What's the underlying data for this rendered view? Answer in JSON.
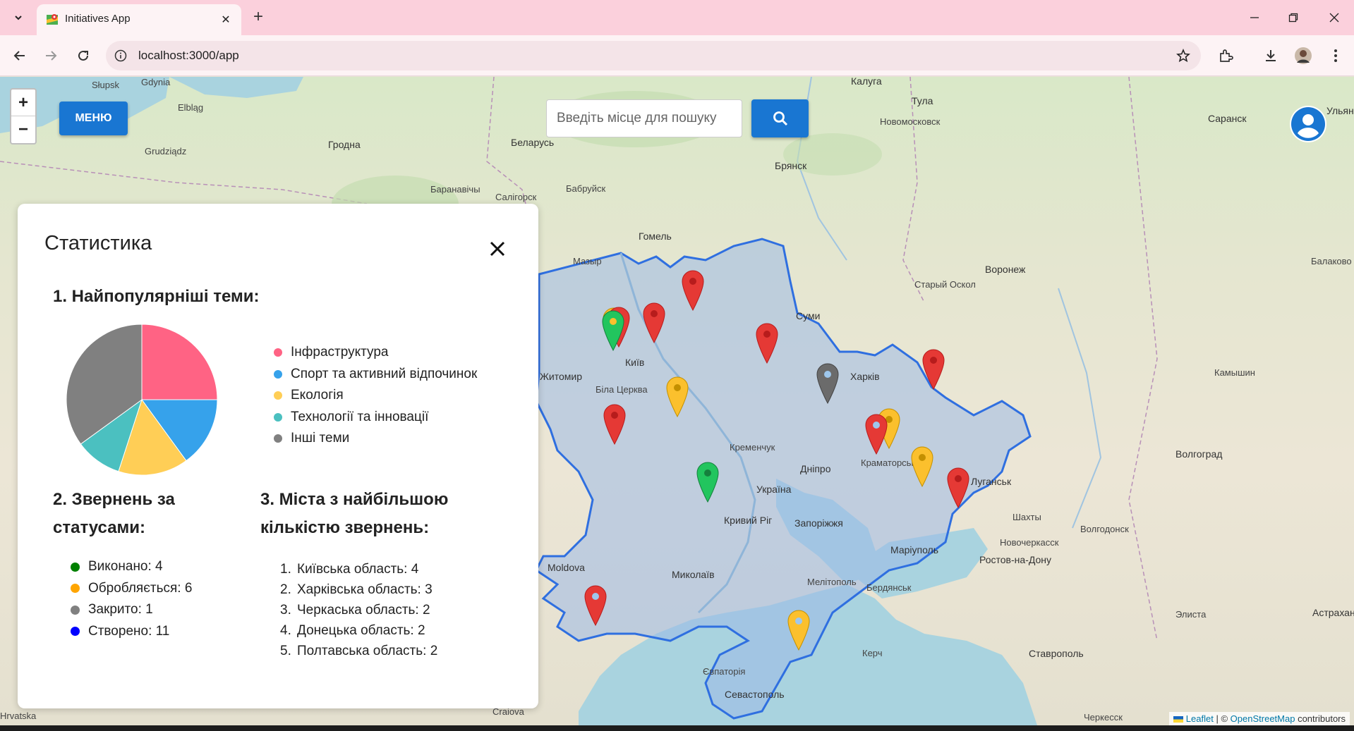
{
  "browser": {
    "tab_title": "Initiatives App",
    "url": "localhost:3000/app"
  },
  "map": {
    "menu_label": "МЕНЮ",
    "search_placeholder": "Введіть місце для пошуку",
    "zoom_in": "+",
    "zoom_out": "−",
    "attribution": {
      "leaflet": "Leaflet",
      "separator": "| ©",
      "osm": "OpenStreetMap",
      "contributors": "contributors"
    },
    "labels": [
      {
        "name": "Słupsk"
      },
      {
        "name": "Gdynia"
      },
      {
        "name": "Elbląg"
      },
      {
        "name": "Grudziądz"
      },
      {
        "name": "Калуга"
      },
      {
        "name": "Тула"
      },
      {
        "name": "Новомосковск"
      },
      {
        "name": "Саранск"
      },
      {
        "name": "Ульяновск"
      },
      {
        "name": "Гродна"
      },
      {
        "name": "Беларусь"
      },
      {
        "name": "Брянск"
      },
      {
        "name": "Баранавічы"
      },
      {
        "name": "Бабруйск"
      },
      {
        "name": "Салігорск"
      },
      {
        "name": "Гомель"
      },
      {
        "name": "Мазыр"
      },
      {
        "name": "Старый Оскол"
      },
      {
        "name": "Воронеж"
      },
      {
        "name": "Балаково"
      },
      {
        "name": "Суми"
      },
      {
        "name": "Житомир"
      },
      {
        "name": "Київ"
      },
      {
        "name": "Біла Церква"
      },
      {
        "name": "Харків"
      },
      {
        "name": "Камышин"
      },
      {
        "name": "Кременчук"
      },
      {
        "name": "Дніпро"
      },
      {
        "name": "Україна"
      },
      {
        "name": "Краматорськ"
      },
      {
        "name": "Луганськ"
      },
      {
        "name": "Волгоград"
      },
      {
        "name": "Кривий Ріг"
      },
      {
        "name": "Запоріжжя"
      },
      {
        "name": "Маріуполь"
      },
      {
        "name": "Шахты"
      },
      {
        "name": "Волгодонск"
      },
      {
        "name": "Новочеркасск"
      },
      {
        "name": "Ростов-на-Дону"
      },
      {
        "name": "Moldova"
      },
      {
        "name": "Миколаїв"
      },
      {
        "name": "Мелітополь"
      },
      {
        "name": "Бердянськ"
      },
      {
        "name": "Элиста"
      },
      {
        "name": "Астрахань"
      },
      {
        "name": "Керч"
      },
      {
        "name": "Ставрополь"
      },
      {
        "name": "Євпаторія"
      },
      {
        "name": "Севастополь"
      },
      {
        "name": "Craiova"
      },
      {
        "name": "Hrvatska"
      },
      {
        "name": "Черкесск"
      }
    ]
  },
  "stats": {
    "title": "Статистика",
    "section1_title": "1. Найпопулярніші теми:",
    "section2_title_line1": "2. Звернень за",
    "section2_title_line2": "статусами:",
    "section3_title_line1": "3. Міста з найбільшою",
    "section3_title_line2": "кількістю звернень:",
    "topics": [
      {
        "label": "Інфраструктура",
        "color": "#ff6384"
      },
      {
        "label": "Спорт та активний відпочинок",
        "color": "#36a2eb"
      },
      {
        "label": "Екологія",
        "color": "#ffce56"
      },
      {
        "label": "Технології та інновації",
        "color": "#4bc0c0"
      },
      {
        "label": "Інші теми",
        "color": "#808080"
      }
    ],
    "statuses": [
      {
        "label": "Виконано: 4",
        "color": "#008000"
      },
      {
        "label": "Обробляється: 6",
        "color": "#ffa500"
      },
      {
        "label": "Закрито: 1",
        "color": "#808080"
      },
      {
        "label": "Створено: 11",
        "color": "#0000ff"
      }
    ],
    "cities": [
      {
        "num": "1.",
        "label": "Київська область: 4"
      },
      {
        "num": "2.",
        "label": "Харківська область: 3"
      },
      {
        "num": "3.",
        "label": "Черкаська область: 2"
      },
      {
        "num": "4.",
        "label": "Донецька область: 2"
      },
      {
        "num": "5.",
        "label": "Полтавська область: 2"
      }
    ]
  },
  "chart_data": {
    "type": "pie",
    "categories": [
      "Інфраструктура",
      "Спорт та активний відпочинок",
      "Екологія",
      "Технології та інновації",
      "Інші теми"
    ],
    "values": [
      5,
      3,
      3,
      2,
      7
    ],
    "colors": [
      "#ff6384",
      "#36a2eb",
      "#ffce56",
      "#4bc0c0",
      "#808080"
    ]
  }
}
